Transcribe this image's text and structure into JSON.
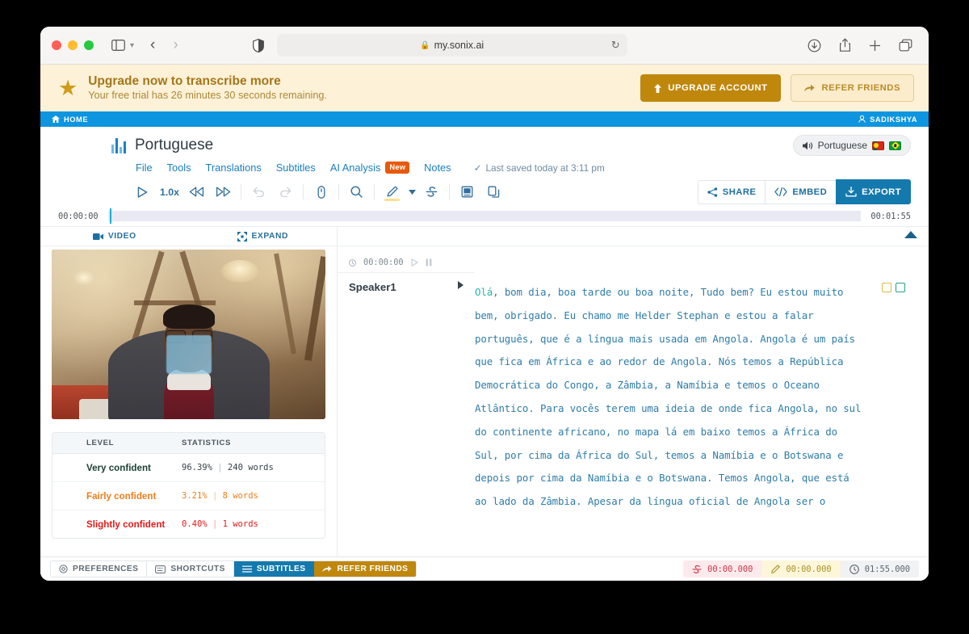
{
  "browser": {
    "url": "my.sonix.ai",
    "lock_icon": "lock-icon",
    "reload_icon": "reload-icon",
    "back_icon": "back-arrow-icon",
    "forward_icon": "forward-arrow-icon",
    "sidebar_icon": "sidebar-toggle-icon",
    "chevron_icon": "chevron-down-icon",
    "shield_icon": "privacy-shield-icon",
    "download_icon": "download-icon",
    "share_icon": "share-icon",
    "newtab_icon": "plus-icon",
    "tabs_icon": "tab-overview-icon"
  },
  "banner": {
    "star_icon": "star-icon",
    "title": "Upgrade now to transcribe more",
    "subtitle": "Your free trial has 26 minutes 30 seconds remaining.",
    "upgrade_label": "UPGRADE ACCOUNT",
    "refer_label": "REFER FRIENDS",
    "upgrade_color": "#c0870d",
    "bg_color": "#fdf2d8"
  },
  "homebar": {
    "home_label": "HOME",
    "user_label": "SADIKSHYA",
    "bg_color": "#0d96df"
  },
  "header": {
    "title": "Portuguese",
    "language_pill": {
      "label": "Portuguese",
      "speaker_icon": "speaker-icon",
      "flags": [
        "portugal-flag",
        "brazil-flag"
      ]
    },
    "menu": [
      {
        "label": "File"
      },
      {
        "label": "Tools"
      },
      {
        "label": "Translations"
      },
      {
        "label": "Subtitles"
      },
      {
        "label": "AI Analysis",
        "badge": "New"
      },
      {
        "label": "Notes"
      }
    ],
    "saved_status": "Last saved today at 3:11 pm"
  },
  "toolbar": {
    "play_icon": "play-icon",
    "speed": "1.0x",
    "rewind_icon": "rewind-icon",
    "forward_icon": "fast-forward-icon",
    "undo_icon": "undo-icon",
    "redo_icon": "redo-icon",
    "attach_icon": "paperclip-icon",
    "search_icon": "search-icon",
    "highlight_icon": "highlighter-icon",
    "highlight_caret_icon": "chevron-down-icon",
    "strikethrough_icon": "strikethrough-icon",
    "glossary_icon": "glossary-icon",
    "copy_icon": "copy-icon",
    "share_label": "SHARE",
    "embed_label": "EMBED",
    "export_label": "EXPORT"
  },
  "timeline": {
    "start": "00:00:00",
    "end": "00:01:55"
  },
  "left_panel": {
    "tabs": [
      {
        "label": "VIDEO",
        "icon": "video-camera-icon"
      },
      {
        "label": "EXPAND",
        "icon": "expand-icon"
      }
    ],
    "stats": {
      "headers": [
        "LEVEL",
        "STATISTICS"
      ],
      "rows": [
        {
          "swatch": "#0d3b22",
          "level": "Very confident",
          "percent": "96.39%",
          "words": "240 words",
          "color": "#1d3f33"
        },
        {
          "swatch": "#f97316",
          "level": "Fairly confident",
          "percent": "3.21%",
          "words": "8 words",
          "color": "#ef7d1a"
        },
        {
          "swatch": "#ee1111",
          "level": "Slightly confident",
          "percent": "0.40%",
          "words": "1 words",
          "color": "#e61919"
        }
      ]
    }
  },
  "transcript": {
    "segment_time": "00:00:00",
    "clock_icon": "clock-icon",
    "play_icon": "play-icon",
    "pause_icon": "pause-icon",
    "speaker": "Speaker1",
    "speaker_caret_icon": "caret-right-icon",
    "first_word": "Olá",
    "text": ", bom dia, boa tarde ou boa noite, Tudo bem? Eu estou muito bem, obrigado. Eu chamo me Helder Stephan e estou a falar português, que é a língua mais usada em Angola. Angola é um país que fica em África e ao redor de Angola. Nós temos a República Democrática do Congo, a Zâmbia, a Namíbia e temos o Oceano Atlântico. Para vocês terem uma ideia de onde fica Angola, no sul do continente africano, no mapa lá em baixo temos a África do Sul, por cima da África do Sul, temos a Namíbia e o Botswana e depois por cima da Namíbia e o Botswana. Temos Angola, que está ao lado da Zâmbia. Apesar da língua oficial de Angola ser o",
    "note_icons": [
      "note-yellow-icon",
      "note-green-icon"
    ],
    "collapse_icon": "collapse-caret-icon"
  },
  "statusbar": {
    "buttons": [
      {
        "label": "PREFERENCES",
        "icon": "gear-icon",
        "style": "plain"
      },
      {
        "label": "SHORTCUTS",
        "icon": "keyboard-icon",
        "style": "plain"
      },
      {
        "label": "SUBTITLES",
        "icon": "subtitles-icon",
        "style": "blue"
      },
      {
        "label": "REFER FRIENDS",
        "icon": "refer-icon",
        "style": "gold"
      }
    ],
    "timecodes": [
      {
        "icon": "strikethrough-icon",
        "value": "00:00.000",
        "style": "red"
      },
      {
        "icon": "pencil-icon",
        "value": "00:00.000",
        "style": "yellow"
      },
      {
        "icon": "clock-icon",
        "value": "01:55.000",
        "style": "gray"
      }
    ]
  }
}
